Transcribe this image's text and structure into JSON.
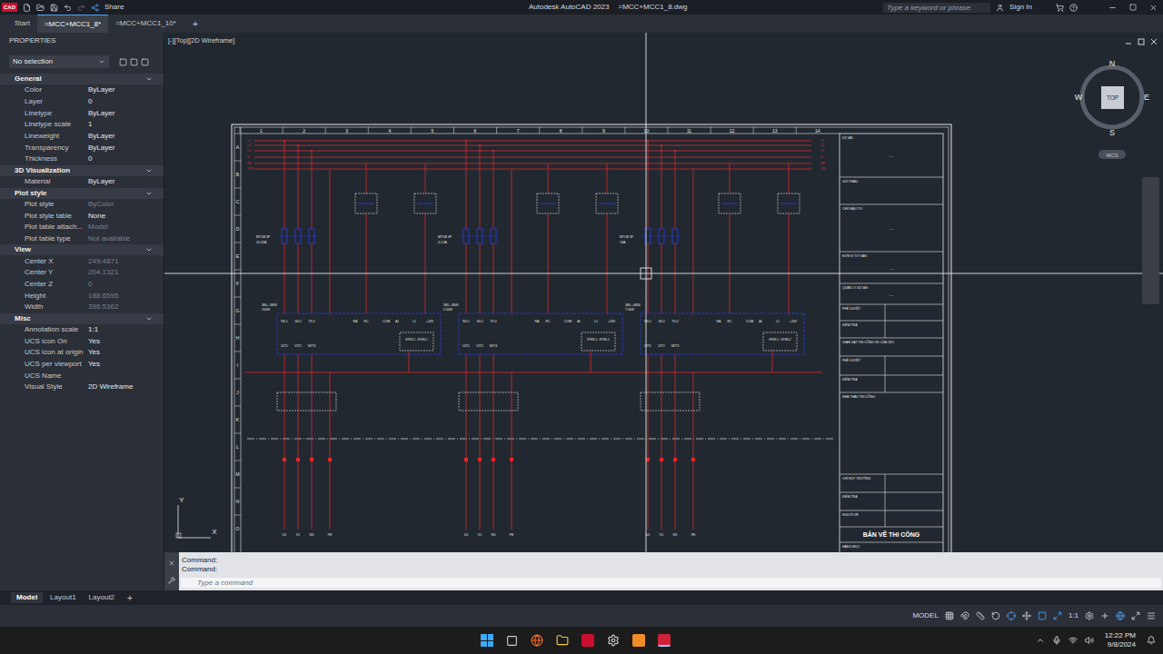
{
  "window": {
    "logo": "CAD",
    "app": "Autodesk AutoCAD 2023",
    "file": "=MCC+MCC1_8.dwg",
    "search_placeholder": "Type a keyword or phrase",
    "sign_in": "Sign In",
    "share": "Share"
  },
  "tabs": [
    {
      "label": "Start",
      "selected": false
    },
    {
      "label": "=MCC+MCC1_8*",
      "selected": true
    },
    {
      "label": "=MCC+MCC1_10*",
      "selected": false
    }
  ],
  "new_tab": "+",
  "properties": {
    "title": "PROPERTIES",
    "selection": "No selection",
    "sections": [
      {
        "title": "General",
        "expanded": true,
        "rows": [
          {
            "label": "Color",
            "value": "ByLayer",
            "disabled": false
          },
          {
            "label": "Layer",
            "value": "0",
            "disabled": false
          },
          {
            "label": "Linetype",
            "value": "ByLayer",
            "disabled": false
          },
          {
            "label": "Linetype scale",
            "value": "1",
            "disabled": false
          },
          {
            "label": "Lineweight",
            "value": "ByLayer",
            "disabled": false
          },
          {
            "label": "Transparency",
            "value": "ByLayer",
            "disabled": false
          },
          {
            "label": "Thickness",
            "value": "0",
            "disabled": false
          }
        ]
      },
      {
        "title": "3D Visualization",
        "expanded": true,
        "rows": [
          {
            "label": "Material",
            "value": "ByLayer",
            "disabled": false
          }
        ]
      },
      {
        "title": "Plot style",
        "expanded": true,
        "rows": [
          {
            "label": "Plot style",
            "value": "ByColor",
            "disabled": true
          },
          {
            "label": "Plot style table",
            "value": "None",
            "disabled": false
          },
          {
            "label": "Plot table attach...",
            "value": "Model",
            "disabled": true
          },
          {
            "label": "Plot table type",
            "value": "Not available",
            "disabled": true
          }
        ]
      },
      {
        "title": "View",
        "expanded": true,
        "rows": [
          {
            "label": "Center X",
            "value": "249.4871",
            "disabled": true
          },
          {
            "label": "Center Y",
            "value": "204.1321",
            "disabled": true
          },
          {
            "label": "Center Z",
            "value": "0",
            "disabled": true
          },
          {
            "label": "Height",
            "value": "188.6595",
            "disabled": true
          },
          {
            "label": "Width",
            "value": "396.5362",
            "disabled": true
          }
        ]
      },
      {
        "title": "Misc",
        "expanded": true,
        "rows": [
          {
            "label": "Annotation scale",
            "value": "1:1",
            "disabled": false
          },
          {
            "label": "UCS icon On",
            "value": "Yes",
            "disabled": false
          },
          {
            "label": "UCS icon at origin",
            "value": "Yes",
            "disabled": false
          },
          {
            "label": "UCS per viewport",
            "value": "Yes",
            "disabled": false
          },
          {
            "label": "UCS Name",
            "value": "",
            "disabled": false
          },
          {
            "label": "Visual Style",
            "value": "2D Wireframe",
            "disabled": false
          }
        ]
      }
    ]
  },
  "viewport": {
    "label": "[-][Top][2D Wireframe]",
    "viewcube": {
      "n": "N",
      "s": "S",
      "e": "E",
      "w": "W",
      "face": "TOP",
      "ucs": "WCS"
    },
    "ucs_icon": {
      "x": "X",
      "y": "Y"
    }
  },
  "drawing": {
    "columns": [
      "1",
      "2",
      "3",
      "4",
      "5",
      "6",
      "7",
      "8",
      "9",
      "10",
      "11",
      "12",
      "13",
      "14"
    ],
    "rows": [
      "A",
      "B",
      "C",
      "D",
      "E",
      "F",
      "G",
      "H",
      "I",
      "J",
      "K",
      "L",
      "M",
      "N",
      "O"
    ],
    "bus": [
      {
        "label": "L1"
      },
      {
        "label": "L2"
      },
      {
        "label": "L3"
      },
      {
        "label": "N"
      },
      {
        "label": "PE"
      },
      {
        "label": "24V"
      }
    ],
    "modules": [
      {
        "breaker": "MTCB 3P",
        "rating": "24-32A",
        "supply": "380...480V",
        "power": "15kW",
        "inputs": [
          "R/L1",
          "S/L2",
          "T/L3"
        ],
        "controls": [
          "RA",
          "RC",
          "COM",
          "AI",
          "L1",
          "+24V"
        ],
        "outputs": [
          "U/T1",
          "V/T2",
          "W/T3"
        ],
        "comm": "ETHS-1 - ETHS-2",
        "terminals": [
          "U1",
          "V1",
          "W1",
          "PE"
        ]
      },
      {
        "breaker": "MTCB 3P",
        "rating": "U-12A",
        "supply": "380...480V",
        "power": "5.5kW",
        "inputs": [
          "R/L1",
          "S/L2",
          "T/L3"
        ],
        "controls": [
          "RA",
          "RC",
          "COM",
          "AI",
          "L1",
          "+24V"
        ],
        "outputs": [
          "U/T1",
          "V/T2",
          "W/T3"
        ],
        "comm": "ETHS-1 - ETHS-2",
        "terminals": [
          "U1",
          "V1",
          "W1",
          "PE"
        ]
      },
      {
        "breaker": "MTCB 3P",
        "rating": "13A",
        "supply": "380...480V",
        "power": "7.5kW",
        "inputs": [
          "R/L1",
          "S/L2",
          "T/L3"
        ],
        "controls": [
          "RA",
          "RC",
          "COM",
          "AI",
          "L1",
          "+24V"
        ],
        "outputs": [
          "U/T1",
          "V/T2",
          "W/T3"
        ],
        "comm": "ETHS-1 - ETHS-2",
        "terminals": [
          "U1",
          "V1",
          "W1",
          "PE"
        ]
      }
    ],
    "title_block": [
      {
        "label": "DỰ ÁN:",
        "value": "---",
        "kind": "field"
      },
      {
        "label": "GÓI THẦU:",
        "value": "",
        "kind": "field"
      },
      {
        "label": "CHỦ ĐẦU TƯ:",
        "value": "---",
        "kind": "field"
      },
      {
        "label": "ĐƠN VỊ TƯ VẤN:",
        "value": "---",
        "kind": "field"
      },
      {
        "label": "QUẢN LÝ DỰ ÁN:",
        "value": "---",
        "kind": "field"
      },
      {
        "label": "PHÊ DUYỆT",
        "value": "",
        "kind": "sign"
      },
      {
        "label": "KIỂM TRA",
        "value": "",
        "kind": "sign"
      },
      {
        "label": "GIÁM SÁT THI CÔNG XD CỦA CĐT:",
        "value": "",
        "kind": "field"
      },
      {
        "label": "PHÊ DUYỆT",
        "value": "",
        "kind": "sign"
      },
      {
        "label": "KIỂM TRA",
        "value": "",
        "kind": "sign"
      },
      {
        "label": "NHÀ THẦU THI CÔNG:",
        "value": "",
        "kind": "field"
      },
      {
        "label": "CHỈ HUY TRƯỞNG",
        "value": "",
        "kind": "sign"
      },
      {
        "label": "KIỂM TRA",
        "value": "",
        "kind": "sign"
      },
      {
        "label": "NGƯỜI VẼ",
        "value": "",
        "kind": "sign"
      },
      {
        "label": "BẢN VẼ THI CÔNG",
        "value": "",
        "kind": "banner"
      },
      {
        "label": "HẠNG MỤC:",
        "value": "",
        "kind": "field"
      }
    ]
  },
  "command": {
    "history": [
      "Command:",
      "Command:"
    ],
    "placeholder": "Type a command"
  },
  "layout_tabs": [
    {
      "label": "Model",
      "selected": true
    },
    {
      "label": "Layout1",
      "selected": false
    },
    {
      "label": "Layout2",
      "selected": false
    }
  ],
  "new_layout": "+",
  "status_bar": {
    "mode": "MODEL",
    "scale": "1:1"
  },
  "taskbar": {
    "time": "12:22 PM",
    "date": "9/8/2024"
  }
}
